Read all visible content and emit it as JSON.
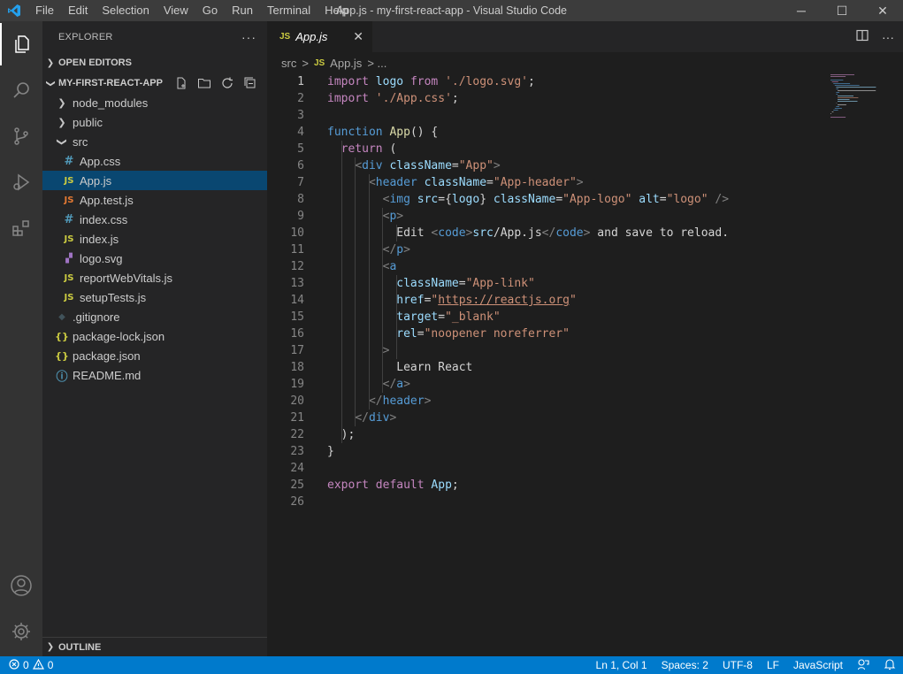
{
  "window": {
    "title": "App.js - my-first-react-app - Visual Studio Code",
    "menu": [
      "File",
      "Edit",
      "Selection",
      "View",
      "Go",
      "Run",
      "Terminal",
      "Help"
    ],
    "controls": [
      "minimize",
      "maximize",
      "close"
    ]
  },
  "activity_bar": {
    "items": [
      "explorer-icon",
      "search-icon",
      "source-control-icon",
      "run-debug-icon",
      "extensions-icon"
    ],
    "bottom": [
      "account-icon",
      "settings-gear-icon"
    ]
  },
  "sidebar": {
    "title": "EXPLORER",
    "more": "···",
    "open_editors": "OPEN EDITORS",
    "project": "MY-FIRST-REACT-APP",
    "outline": "OUTLINE",
    "tree": [
      {
        "label": "node_modules",
        "type": "folder",
        "depth": 1,
        "expanded": false
      },
      {
        "label": "public",
        "type": "folder",
        "depth": 1,
        "expanded": false
      },
      {
        "label": "src",
        "type": "folder",
        "depth": 1,
        "expanded": true
      },
      {
        "label": "App.css",
        "type": "css",
        "depth": 2,
        "icon": "#"
      },
      {
        "label": "App.js",
        "type": "js",
        "depth": 2,
        "icon": "JS",
        "selected": true
      },
      {
        "label": "App.test.js",
        "type": "test",
        "depth": 2,
        "icon": "JS"
      },
      {
        "label": "index.css",
        "type": "css",
        "depth": 2,
        "icon": "#"
      },
      {
        "label": "index.js",
        "type": "js",
        "depth": 2,
        "icon": "JS"
      },
      {
        "label": "logo.svg",
        "type": "svg",
        "depth": 2,
        "icon": "▞"
      },
      {
        "label": "reportWebVitals.js",
        "type": "js",
        "depth": 2,
        "icon": "JS"
      },
      {
        "label": "setupTests.js",
        "type": "js",
        "depth": 2,
        "icon": "JS"
      },
      {
        "label": ".gitignore",
        "type": "git",
        "depth": 1,
        "icon": "◆"
      },
      {
        "label": "package-lock.json",
        "type": "json",
        "depth": 1,
        "icon": "{}"
      },
      {
        "label": "package.json",
        "type": "json",
        "depth": 1,
        "icon": "{}"
      },
      {
        "label": "README.md",
        "type": "info",
        "depth": 1,
        "icon": "ⓘ"
      }
    ]
  },
  "editor": {
    "tab": {
      "badge": "JS",
      "label": "App.js",
      "close": "✕"
    },
    "breadcrumb": {
      "folder": "src",
      "sep": ">",
      "badge": "JS",
      "file": "App.js",
      "tail": "> ..."
    },
    "code_lines": [
      "import logo from './logo.svg';",
      "import './App.css';",
      "",
      "function App() {",
      "  return (",
      "    <div className=\"App\">",
      "      <header className=\"App-header\">",
      "        <img src={logo} className=\"App-logo\" alt=\"logo\" />",
      "        <p>",
      "          Edit <code>src/App.js</code> and save to reload.",
      "        </p>",
      "        <a",
      "          className=\"App-link\"",
      "          href=\"https://reactjs.org\"",
      "          target=\"_blank\"",
      "          rel=\"noopener noreferrer\"",
      "        >",
      "          Learn React",
      "        </a>",
      "      </header>",
      "    </div>",
      "  );",
      "}",
      "",
      "export default App;",
      ""
    ]
  },
  "statusbar": {
    "errors": "0",
    "warnings": "0",
    "position": "Ln 1, Col 1",
    "spaces": "Spaces: 2",
    "encoding": "UTF-8",
    "eol": "LF",
    "language": "JavaScript"
  },
  "colors": {
    "accent": "#007acc",
    "selection": "#094771",
    "js_badge": "#cbcb41",
    "css_badge": "#519aba",
    "test_badge": "#e37933",
    "json_badge": "#cbcb41"
  }
}
